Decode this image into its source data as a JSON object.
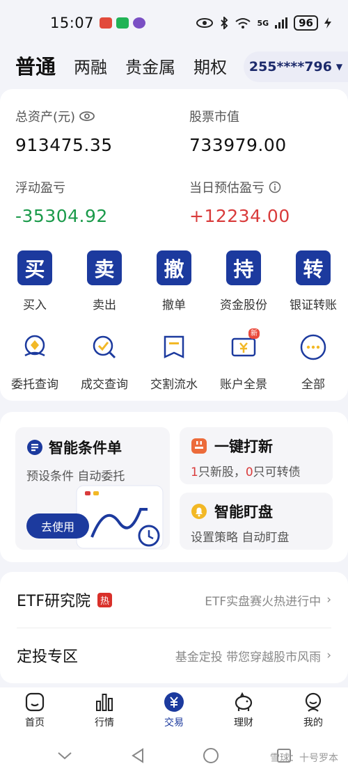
{
  "status": {
    "time": "15:07",
    "network": "5G",
    "battery": "96"
  },
  "tabs": [
    "普通",
    "两融",
    "贵金属",
    "期权"
  ],
  "account": {
    "id": "255****796"
  },
  "assets": {
    "total_label": "总资产(元)",
    "total_value": "913475.35",
    "stock_label": "股票市值",
    "stock_value": "733979.00",
    "float_label": "浮动盈亏",
    "float_value": "-35304.92",
    "today_label": "当日预估盈亏",
    "today_value": "+12234.00"
  },
  "actions": [
    {
      "glyph": "买",
      "label": "买入"
    },
    {
      "glyph": "卖",
      "label": "卖出"
    },
    {
      "glyph": "撤",
      "label": "撤单"
    },
    {
      "glyph": "持",
      "label": "资金股份"
    },
    {
      "glyph": "转",
      "label": "银证转账"
    }
  ],
  "queries": [
    {
      "icon": "entrust-icon",
      "label": "委托查询"
    },
    {
      "icon": "deal-icon",
      "label": "成交查询"
    },
    {
      "icon": "ledger-icon",
      "label": "交割流水"
    },
    {
      "icon": "overview-icon",
      "label": "账户全景",
      "badge": "新"
    },
    {
      "icon": "more-icon",
      "label": "全部"
    }
  ],
  "features": {
    "smart_order": {
      "title": "智能条件单",
      "subtitle": "预设条件 自动委托",
      "button": "去使用"
    },
    "ipo": {
      "title": "一键打新",
      "n1": "1",
      "t1": "只新股，",
      "n2": "0",
      "t2": "只可转债"
    },
    "monitor": {
      "title": "智能盯盘",
      "subtitle": "设置策略 自动盯盘"
    }
  },
  "list": [
    {
      "title": "ETF研究院",
      "badge": "热",
      "desc": "ETF实盘赛火热进行中"
    },
    {
      "title": "定投专区",
      "desc": "基金定投 带您穿越股市风雨"
    }
  ],
  "bottom_nav": [
    "首页",
    "行情",
    "交易",
    "理财",
    "我的"
  ],
  "bottom_nav_active": "交易",
  "watermark": "雪球：十号罗本",
  "colors": {
    "brand": "#1c3a9e",
    "up": "#d93b3b",
    "down": "#1a9a4a"
  }
}
